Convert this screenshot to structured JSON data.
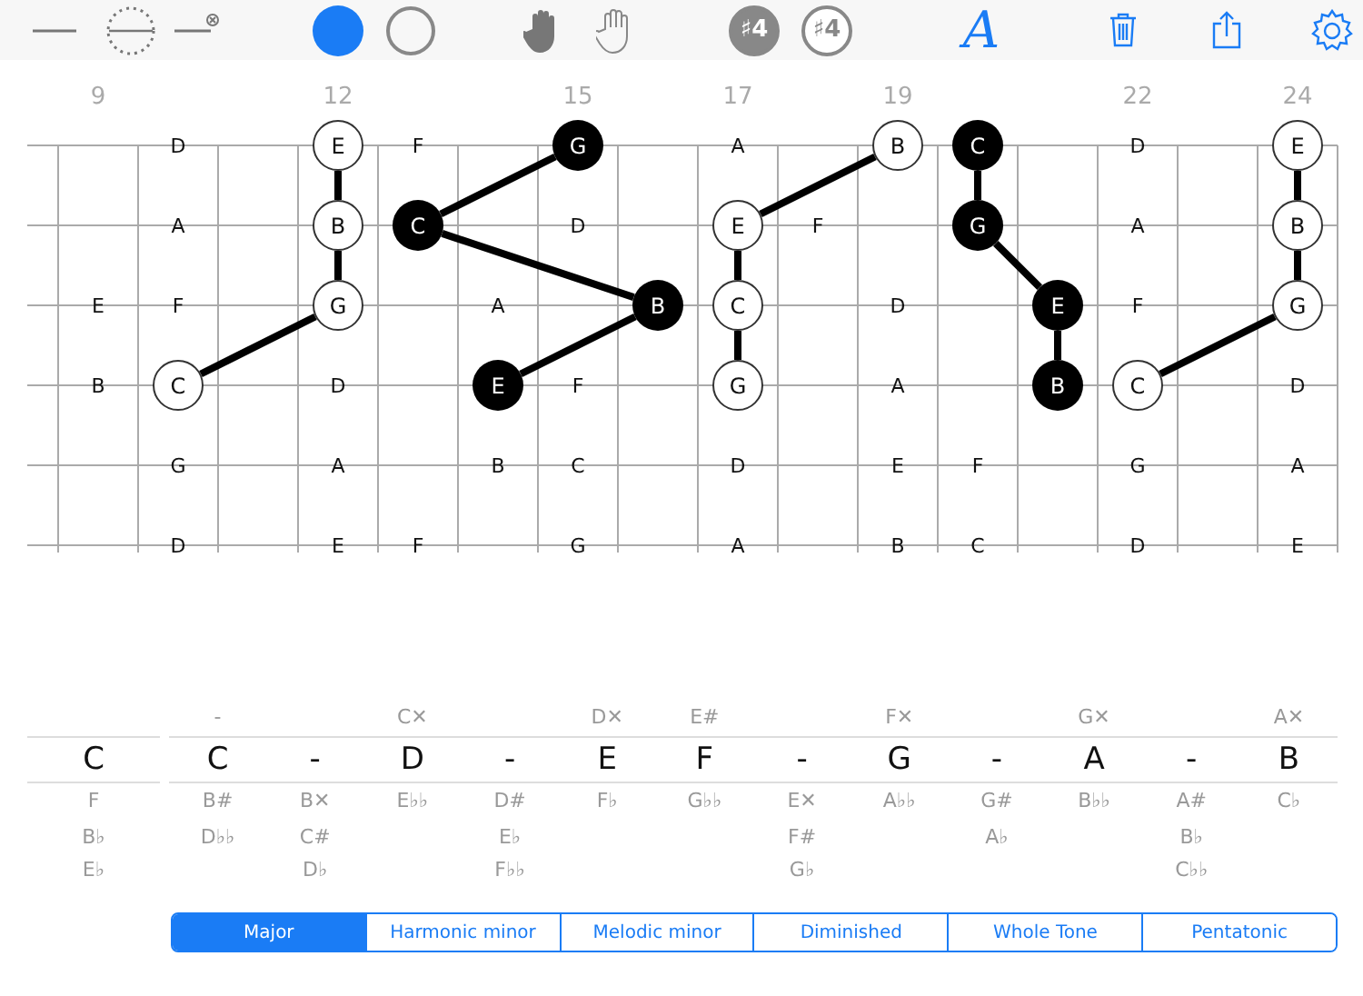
{
  "toolbar": {
    "sharp_buttons": [
      "♯4",
      "♯4"
    ],
    "font_button": "A"
  },
  "frets": [
    {
      "number": "9",
      "notes": [
        {
          "kind": "empty"
        },
        {
          "kind": "empty"
        },
        {
          "note": "E",
          "kind": "plain"
        },
        {
          "note": "B",
          "kind": "plain"
        },
        {
          "kind": "empty"
        },
        {
          "kind": "empty"
        }
      ]
    },
    {
      "notes": [
        {
          "note": "D",
          "kind": "plain"
        },
        {
          "note": "A",
          "kind": "plain"
        },
        {
          "note": "F",
          "kind": "plain"
        },
        {
          "note": "C",
          "kind": "open"
        },
        {
          "note": "G",
          "kind": "plain"
        },
        {
          "note": "D",
          "kind": "plain"
        }
      ]
    },
    {
      "notes": [
        {
          "kind": "empty"
        },
        {
          "kind": "empty"
        },
        {
          "kind": "empty"
        },
        {
          "kind": "empty"
        },
        {
          "kind": "empty"
        },
        {
          "kind": "empty"
        }
      ]
    },
    {
      "number": "12",
      "notes": [
        {
          "note": "E",
          "kind": "open"
        },
        {
          "note": "B",
          "kind": "open"
        },
        {
          "note": "G",
          "kind": "open"
        },
        {
          "note": "D",
          "kind": "plain"
        },
        {
          "note": "A",
          "kind": "plain"
        },
        {
          "note": "E",
          "kind": "plain"
        }
      ]
    },
    {
      "notes": [
        {
          "note": "F",
          "kind": "plain"
        },
        {
          "note": "C",
          "kind": "filled"
        },
        {
          "kind": "empty"
        },
        {
          "kind": "empty"
        },
        {
          "kind": "empty"
        },
        {
          "note": "F",
          "kind": "plain"
        }
      ]
    },
    {
      "notes": [
        {
          "kind": "empty"
        },
        {
          "kind": "empty"
        },
        {
          "note": "A",
          "kind": "plain"
        },
        {
          "note": "E",
          "kind": "filled"
        },
        {
          "note": "B",
          "kind": "plain"
        },
        {
          "kind": "empty"
        }
      ]
    },
    {
      "number": "15",
      "notes": [
        {
          "note": "G",
          "kind": "filled"
        },
        {
          "note": "D",
          "kind": "plain"
        },
        {
          "kind": "empty"
        },
        {
          "note": "F",
          "kind": "plain"
        },
        {
          "note": "C",
          "kind": "plain"
        },
        {
          "note": "G",
          "kind": "plain"
        }
      ]
    },
    {
      "notes": [
        {
          "kind": "empty"
        },
        {
          "kind": "empty"
        },
        {
          "note": "B",
          "kind": "filled"
        },
        {
          "kind": "empty"
        },
        {
          "kind": "empty"
        },
        {
          "kind": "empty"
        }
      ]
    },
    {
      "number": "17",
      "notes": [
        {
          "note": "A",
          "kind": "plain"
        },
        {
          "note": "E",
          "kind": "open"
        },
        {
          "note": "C",
          "kind": "open"
        },
        {
          "note": "G",
          "kind": "open"
        },
        {
          "note": "D",
          "kind": "plain"
        },
        {
          "note": "A",
          "kind": "plain"
        }
      ]
    },
    {
      "notes": [
        {
          "kind": "empty"
        },
        {
          "note": "F",
          "kind": "plain"
        },
        {
          "kind": "empty"
        },
        {
          "kind": "empty"
        },
        {
          "kind": "empty"
        },
        {
          "kind": "empty"
        }
      ]
    },
    {
      "number": "19",
      "notes": [
        {
          "note": "B",
          "kind": "open"
        },
        {
          "kind": "empty"
        },
        {
          "note": "D",
          "kind": "plain"
        },
        {
          "note": "A",
          "kind": "plain"
        },
        {
          "note": "E",
          "kind": "plain"
        },
        {
          "note": "B",
          "kind": "plain"
        }
      ]
    },
    {
      "notes": [
        {
          "note": "C",
          "kind": "filled"
        },
        {
          "note": "G",
          "kind": "filled"
        },
        {
          "kind": "empty"
        },
        {
          "kind": "empty"
        },
        {
          "note": "F",
          "kind": "plain"
        },
        {
          "note": "C",
          "kind": "plain"
        }
      ]
    },
    {
      "notes": [
        {
          "kind": "empty"
        },
        {
          "kind": "empty"
        },
        {
          "note": "E",
          "kind": "filled"
        },
        {
          "note": "B",
          "kind": "filled"
        },
        {
          "kind": "empty"
        },
        {
          "kind": "empty"
        }
      ]
    },
    {
      "number": "22",
      "notes": [
        {
          "note": "D",
          "kind": "plain"
        },
        {
          "note": "A",
          "kind": "plain"
        },
        {
          "note": "F",
          "kind": "plain"
        },
        {
          "note": "C",
          "kind": "open"
        },
        {
          "note": "G",
          "kind": "plain"
        },
        {
          "note": "D",
          "kind": "plain"
        }
      ]
    },
    {
      "notes": [
        {
          "kind": "empty"
        },
        {
          "kind": "empty"
        },
        {
          "kind": "empty"
        },
        {
          "kind": "empty"
        },
        {
          "kind": "empty"
        },
        {
          "kind": "empty"
        }
      ]
    },
    {
      "number": "24",
      "notes": [
        {
          "note": "E",
          "kind": "open"
        },
        {
          "note": "B",
          "kind": "open"
        },
        {
          "note": "G",
          "kind": "open"
        },
        {
          "note": "D",
          "kind": "plain"
        },
        {
          "note": "A",
          "kind": "plain"
        },
        {
          "note": "E",
          "kind": "plain"
        }
      ]
    }
  ],
  "scale": {
    "key": {
      "main": "C",
      "below": [
        "F",
        "B♭",
        "E♭"
      ]
    },
    "columns": [
      {
        "above": "-",
        "main": "C",
        "below": [
          "B#",
          "D♭♭"
        ]
      },
      {
        "main": "-",
        "below": [
          "B✕",
          "C#",
          "D♭"
        ]
      },
      {
        "above": "C✕",
        "main": "D",
        "below": [
          "E♭♭"
        ]
      },
      {
        "main": "-",
        "below": [
          "D#",
          "E♭",
          "F♭♭"
        ]
      },
      {
        "above": "D✕",
        "main": "E",
        "below": [
          "F♭"
        ]
      },
      {
        "above": "E#",
        "main": "F",
        "below": [
          "G♭♭"
        ]
      },
      {
        "main": "-",
        "below": [
          "E✕",
          "F#",
          "G♭"
        ]
      },
      {
        "above": "F✕",
        "main": "G",
        "below": [
          "A♭♭"
        ]
      },
      {
        "main": "-",
        "below": [
          "G#",
          "A♭"
        ]
      },
      {
        "above": "G✕",
        "main": "A",
        "below": [
          "B♭♭"
        ]
      },
      {
        "main": "-",
        "below": [
          "A#",
          "B♭",
          "C♭♭"
        ]
      },
      {
        "above": "A✕",
        "main": "B",
        "below": [
          "C♭"
        ]
      }
    ]
  },
  "scale_types": [
    {
      "label": "Major",
      "selected": true
    },
    {
      "label": "Harmonic minor",
      "selected": false
    },
    {
      "label": "Melodic minor",
      "selected": false
    },
    {
      "label": "Diminished",
      "selected": false
    },
    {
      "label": "Whole Tone",
      "selected": false
    },
    {
      "label": "Pentatonic",
      "selected": false
    }
  ]
}
